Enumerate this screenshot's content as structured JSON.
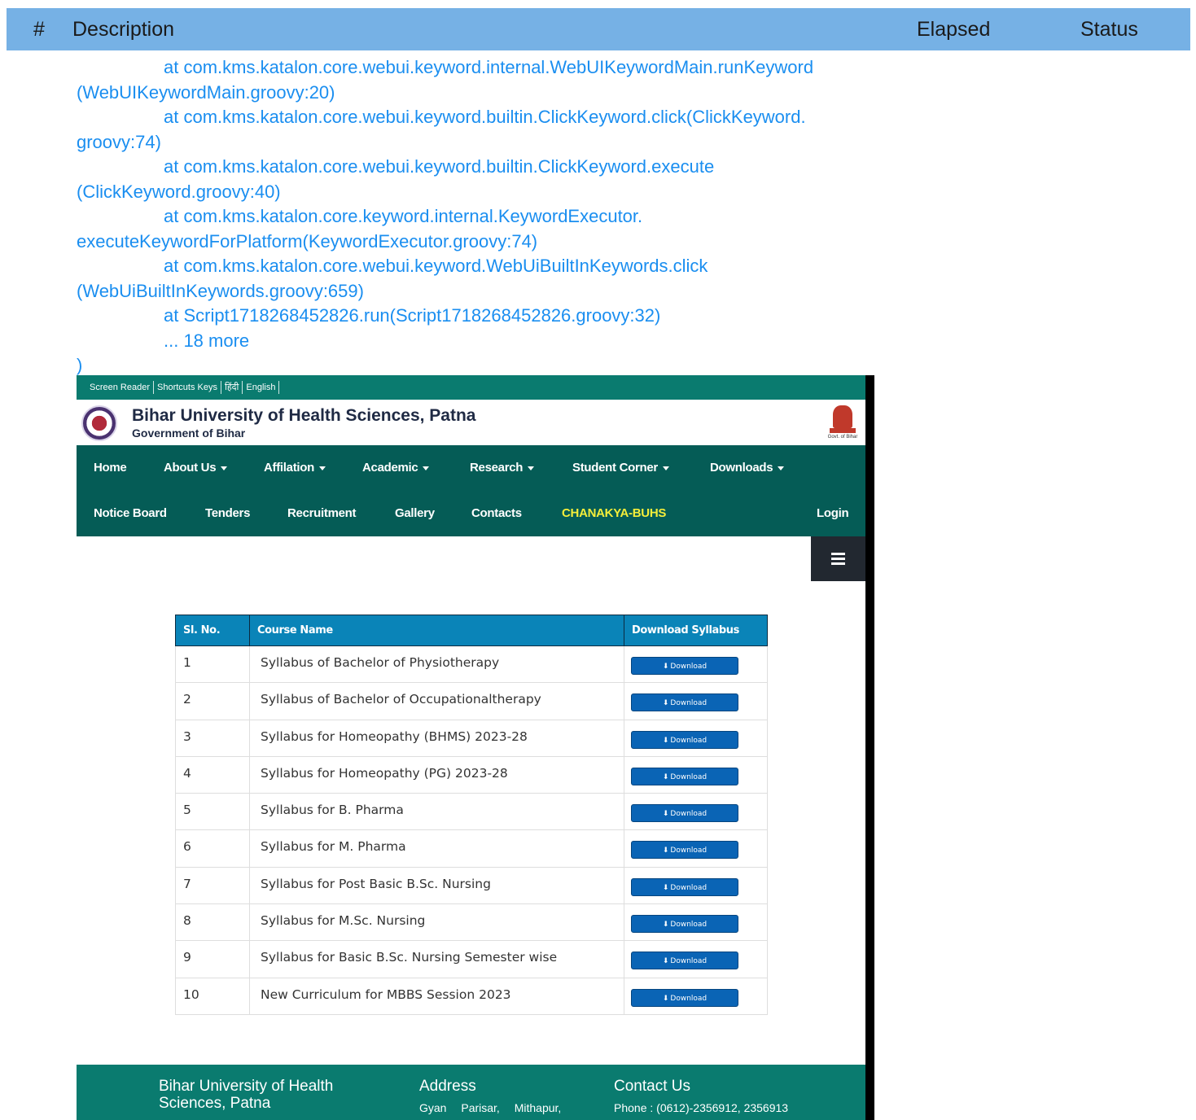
{
  "report": {
    "columns": {
      "hash": "#",
      "description": "Description",
      "elapsed": "Elapsed",
      "status": "Status"
    }
  },
  "trace": {
    "lines": [
      "at com.kms.katalon.core.webui.keyword.internal.WebUIKeywordMain.runKeyword",
      "(WebUIKeywordMain.groovy:20)",
      "at com.kms.katalon.core.webui.keyword.builtin.ClickKeyword.click(ClickKeyword.",
      "groovy:74)",
      "at com.kms.katalon.core.webui.keyword.builtin.ClickKeyword.execute",
      "(ClickKeyword.groovy:40)",
      "at com.kms.katalon.core.keyword.internal.KeywordExecutor.",
      "executeKeywordForPlatform(KeywordExecutor.groovy:74)",
      "at com.kms.katalon.core.webui.keyword.WebUiBuiltInKeywords.click",
      "(WebUiBuiltInKeywords.groovy:659)",
      "at Script1718268452826.run(Script1718268452826.groovy:32)",
      "... 18 more",
      ")"
    ]
  },
  "site": {
    "topbar": [
      "Screen Reader",
      "Shortcuts Keys",
      "हिंदी",
      "English"
    ],
    "brand": {
      "title": "Bihar University of Health Sciences, Patna",
      "subtitle": "Government of Bihar",
      "emblem_caption": "Govt. of Bihar"
    },
    "nav_row1": [
      {
        "label": "Home",
        "caret": false
      },
      {
        "label": "About Us",
        "caret": true
      },
      {
        "label": "Affilation",
        "caret": true
      },
      {
        "label": "Academic",
        "caret": true
      },
      {
        "label": "Research",
        "caret": true
      },
      {
        "label": "Student Corner",
        "caret": true
      },
      {
        "label": "Downloads",
        "caret": true
      }
    ],
    "nav_row2": [
      {
        "label": "Notice Board"
      },
      {
        "label": "Tenders"
      },
      {
        "label": "Recruitment"
      },
      {
        "label": "Gallery"
      },
      {
        "label": "Contacts"
      },
      {
        "label": "CHANAKYA-BUHS"
      },
      {
        "label": "Login"
      }
    ],
    "table": {
      "headers": [
        "Sl. No.",
        "Course Name",
        "Download Syllabus"
      ],
      "button_label": "Download",
      "rows": [
        {
          "no": "1",
          "name": "Syllabus of Bachelor of Physiotherapy"
        },
        {
          "no": "2",
          "name": "Syllabus of Bachelor of Occupationaltherapy"
        },
        {
          "no": "3",
          "name": "Syllabus for Homeopathy (BHMS) 2023-28"
        },
        {
          "no": "4",
          "name": "Syllabus for Homeopathy (PG) 2023-28"
        },
        {
          "no": "5",
          "name": "Syllabus for B. Pharma"
        },
        {
          "no": "6",
          "name": "Syllabus for M. Pharma"
        },
        {
          "no": "7",
          "name": "Syllabus for Post Basic B.Sc. Nursing"
        },
        {
          "no": "8",
          "name": "Syllabus for M.Sc. Nursing"
        },
        {
          "no": "9",
          "name": "Syllabus for Basic B.Sc. Nursing Semester wise"
        },
        {
          "no": "10",
          "name": "New Curriculum for MBBS Session 2023"
        }
      ]
    },
    "footer": {
      "col1_title": "Bihar University of Health Sciences, Patna",
      "col2_title": "Address",
      "col2_text": "Gyan Parisar, Mithapur,",
      "col3_title": "Contact Us",
      "col3_text": "Phone : (0612)-2356912, 2356913"
    }
  },
  "colors": {
    "report_header": "#76b1e5",
    "trace_text": "#1a8ef0",
    "site_teal": "#0a7b6f",
    "nav_dark": "#055c56",
    "highlight": "#f5ee3a",
    "table_header": "#0a84b8",
    "download_button": "#0a64b5"
  }
}
